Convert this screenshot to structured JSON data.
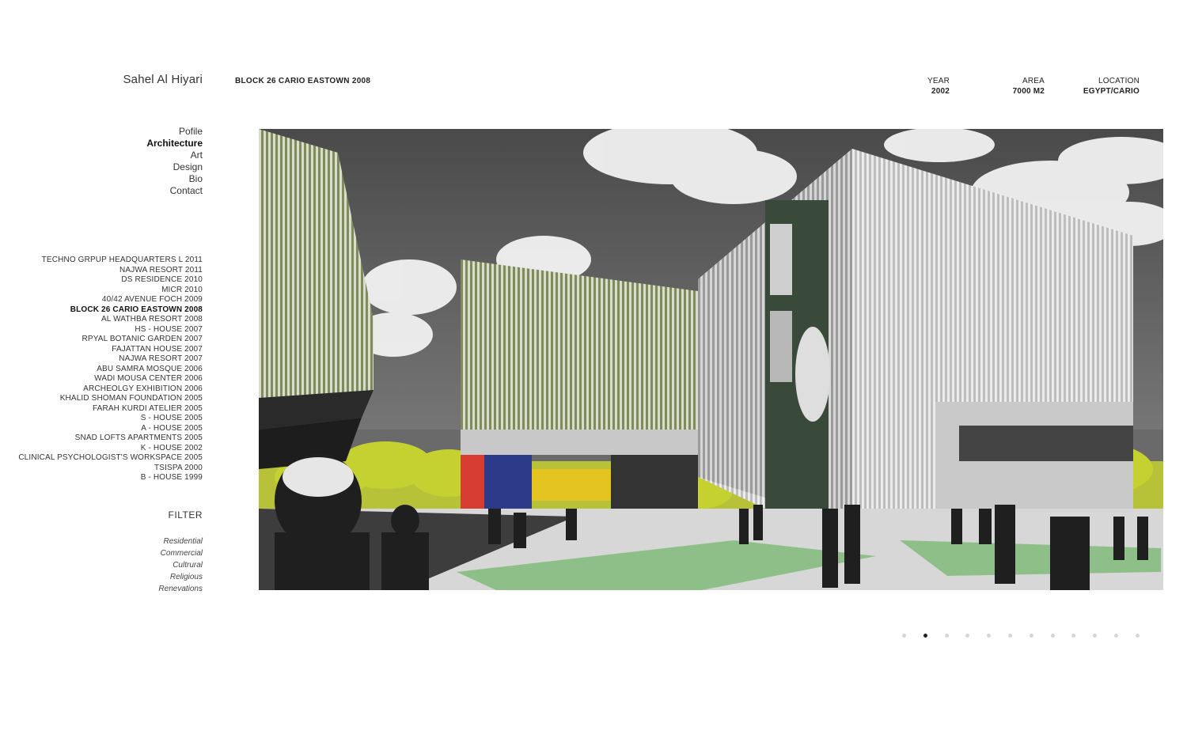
{
  "site": {
    "title": "Sahel Al Hiyari"
  },
  "project": {
    "title": "BLOCK 26 CARIO EASTOWN 2008",
    "year_label": "YEAR",
    "year_value": "2002",
    "area_label": "AREA",
    "area_value": "7000 M2",
    "location_label": "LOCATION",
    "location_value": "EGYPT/CARIO"
  },
  "nav": {
    "items": [
      {
        "label": "Pofile",
        "active": false
      },
      {
        "label": "Architecture",
        "active": true
      },
      {
        "label": "Art",
        "active": false
      },
      {
        "label": "Design",
        "active": false
      },
      {
        "label": "Bio",
        "active": false
      },
      {
        "label": "Contact",
        "active": false
      }
    ]
  },
  "projects": {
    "items": [
      {
        "label": "TECHNO GRPUP HEADQUARTERS L 2011"
      },
      {
        "label": "NAJWA RESORT 2011"
      },
      {
        "label": "DS RESIDENCE 2010"
      },
      {
        "label": "MICR 2010"
      },
      {
        "label": "40/42 AVENUE FOCH 2009"
      },
      {
        "label": "BLOCK 26 CARIO EASTOWN 2008",
        "active": true
      },
      {
        "label": "AL WATHBA RESORT 2008"
      },
      {
        "label": "HS - HOUSE 2007"
      },
      {
        "label": "RPYAL BOTANIC GARDEN 2007"
      },
      {
        "label": "FAJATTAN HOUSE 2007"
      },
      {
        "label": "NAJWA RESORT 2007"
      },
      {
        "label": "ABU SAMRA MOSQUE 2006"
      },
      {
        "label": "WADI MOUSA CENTER 2006"
      },
      {
        "label": "ARCHEOLGY EXHIBITION 2006"
      },
      {
        "label": "KHALID SHOMAN FOUNDATION 2005"
      },
      {
        "label": "FARAH KURDI ATELIER 2005"
      },
      {
        "label": "S - HOUSE 2005"
      },
      {
        "label": "A - HOUSE 2005"
      },
      {
        "label": "SNAD LOFTS APARTMENTS 2005"
      },
      {
        "label": "K - HOUSE 2002"
      },
      {
        "label": "CLINICAL PSYCHOLOGIST'S WORKSPACE 2005"
      },
      {
        "label": "TSISPA 2000"
      },
      {
        "label": "B - HOUSE 1999"
      }
    ]
  },
  "filter": {
    "title": "FILTER",
    "items": [
      "Residential",
      "Commercial",
      "Cultrural",
      "Religious",
      "Renevations"
    ]
  },
  "gallery": {
    "slide_count": 12,
    "active_index": 1
  },
  "colors": {
    "accent_green": "#c4d130",
    "lawn_green": "#8fbf88",
    "sky": "#5a5a5a"
  }
}
